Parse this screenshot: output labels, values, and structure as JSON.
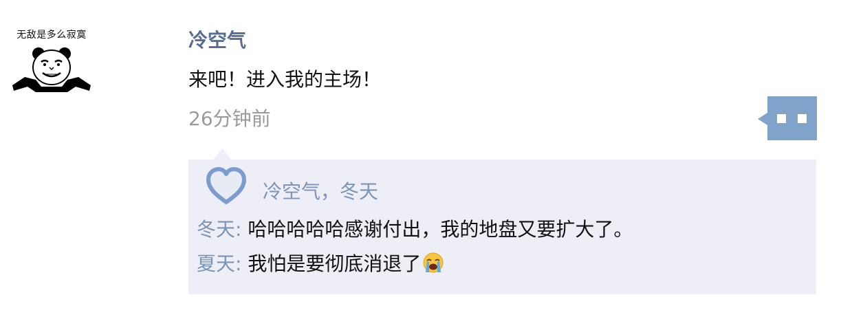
{
  "avatar": {
    "caption": "无敌是多么寂寞",
    "icon": "panda-meme-avatar"
  },
  "post": {
    "author": "冷空气",
    "text": "来吧！进入我的主场！",
    "timestamp": "26分钟前"
  },
  "more_button": {
    "icon": "more-dots-icon",
    "color": "#7fa3c9"
  },
  "interactions": {
    "like_icon": "heart-icon",
    "likers": "冷空气，冬天",
    "comments": [
      {
        "author": "冬天",
        "separator": ":",
        "text": "哈哈哈哈哈感谢付出，我的地盘又要扩大了。"
      },
      {
        "author": "夏天",
        "separator": ":",
        "text": "我怕是要彻底消退了",
        "emoji": "loudly-crying-face-emoji"
      }
    ]
  },
  "colors": {
    "name_link": "#576b95",
    "link_light": "#7c94b5",
    "timestamp": "#9a9a9a",
    "panel_bg": "#eeeef6"
  }
}
